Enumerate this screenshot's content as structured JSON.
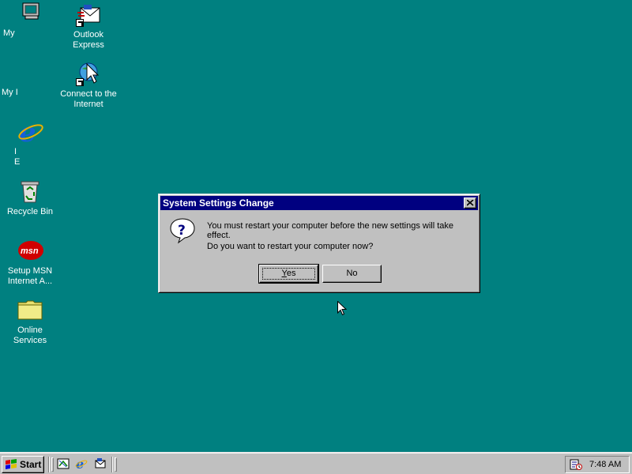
{
  "desktop": {
    "icons": [
      {
        "label": "My"
      },
      {
        "label": "My I"
      },
      {
        "label": "I\nE"
      },
      {
        "label": "Recycle Bin"
      },
      {
        "label": "Setup MSN\nInternet A..."
      },
      {
        "label": "Online\nServices"
      },
      {
        "label": "Outlook\nExpress"
      },
      {
        "label": "Connect to the\nInternet"
      }
    ],
    "msn_logo_text": "msn"
  },
  "dialog": {
    "title": "System Settings Change",
    "message1": "You must restart your computer before the new settings will take effect.",
    "message2": "Do you want to restart your computer now?",
    "yes_mnemonic": "Y",
    "yes_rest": "es",
    "no_label": "No",
    "icon": "question-icon"
  },
  "taskbar": {
    "start_label": "Start",
    "quick_launch": [
      "show-desktop-icon",
      "internet-explorer-icon",
      "outlook-express-icon"
    ],
    "clock": "7:48 AM"
  },
  "colors": {
    "desktop": "#008080",
    "titlebar": "#000080",
    "face": "#c0c0c0"
  }
}
